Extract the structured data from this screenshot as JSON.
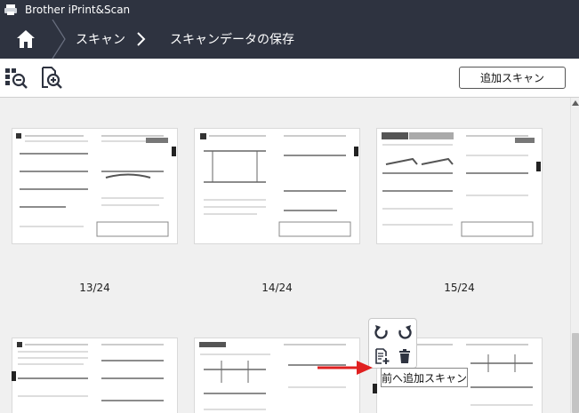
{
  "window": {
    "title": "Brother iPrint&Scan"
  },
  "breadcrumb": {
    "item1": "スキャン",
    "item2": "スキャンデータの保存"
  },
  "toolbar": {
    "add_scan_label": "追加スキャン"
  },
  "pages": [
    {
      "label": "13/24"
    },
    {
      "label": "14/24"
    },
    {
      "label": "15/24"
    }
  ],
  "hover_actions": {
    "tooltip": "前へ追加スキャン",
    "icons": [
      "rotate-left-icon",
      "rotate-right-icon",
      "insert-before-icon",
      "trash-icon"
    ]
  },
  "colors": {
    "header_bg": "#2e3340",
    "content_bg": "#f0f0f0",
    "arrow": "#e02020"
  }
}
